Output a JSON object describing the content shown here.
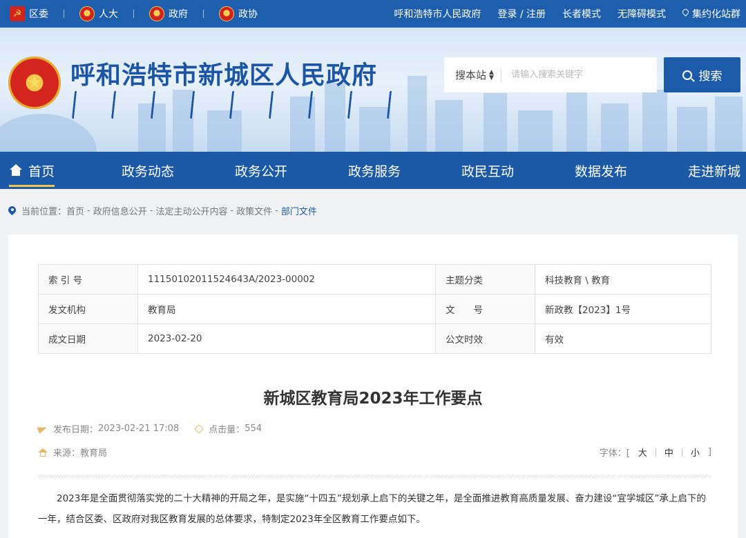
{
  "topbar": {
    "left_links": [
      {
        "label": "区委",
        "icon": "party-emblem-icon"
      },
      {
        "label": "人大",
        "icon": "national-emblem-icon"
      },
      {
        "label": "政府",
        "icon": "national-emblem-icon"
      },
      {
        "label": "政协",
        "icon": "cppcc-emblem-icon"
      }
    ],
    "right_links": [
      "呼和浩特市人民政府",
      "登录 / 注册",
      "长者模式",
      "无障碍模式",
      "集约化站群"
    ]
  },
  "header": {
    "site_title": "呼和浩特市新城区人民政府",
    "search": {
      "scope": "搜本站",
      "placeholder": "请输入搜索关键字",
      "button": "搜索"
    }
  },
  "nav": {
    "items": [
      "首页",
      "政务动态",
      "政务公开",
      "政务服务",
      "政民互动",
      "数据发布",
      "走进新城"
    ]
  },
  "breadcrumb": {
    "prefix": "当前位置：",
    "items": [
      "首页",
      "政府信息公开",
      "法定主动公开内容",
      "政策文件",
      "部门文件"
    ]
  },
  "meta_table": {
    "rows": [
      {
        "k1": "索 引 号",
        "v1": "11150102011524643A/2023-00002",
        "k2": "主题分类",
        "v2": "科技教育 \\ 教育"
      },
      {
        "k1": "发文机构",
        "v1": "教育局",
        "k2": "文　　号",
        "v2": "新政教【2023】1号"
      },
      {
        "k1": "成文日期",
        "v1": "2023-02-20",
        "k2": "公文时效",
        "v2": "有效"
      }
    ]
  },
  "article": {
    "title": "新城区教育局2023年工作要点",
    "publish_label": "发布日期：",
    "publish_date": "2023-02-21 17:08",
    "clicks_label": "点击量：",
    "clicks": "554",
    "source_label": "来源：",
    "source": "教育局",
    "font_label": "字体：[",
    "font_sizes": [
      "大",
      "中",
      "小"
    ],
    "font_close": "]",
    "paragraph": "2023年是全面贯彻落实党的二十大精神的开局之年，是实施“十四五”规划承上启下的关键之年，是全面推进教育高质量发展、奋力建设“宜学城区”承上启下的一年，结合区委、区政府对我区教育发展的总体要求，特制定2023年全区教育工作要点如下。"
  },
  "colors": {
    "primary": "#1c5aa8",
    "topbar": "#1d5fac",
    "accent": "#f3c64a",
    "icon": "#e6b766"
  }
}
